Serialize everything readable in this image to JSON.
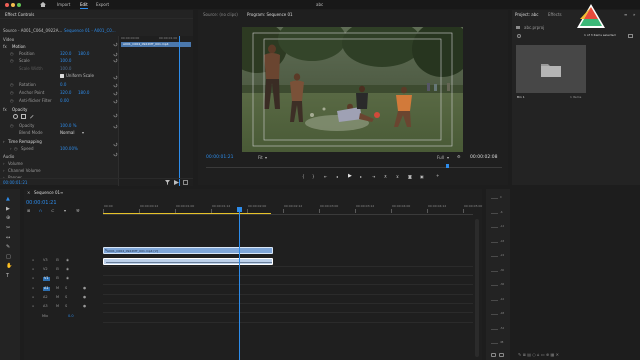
{
  "app": {
    "window_title": "abc",
    "nav": [
      "Import",
      "Edit",
      "Export"
    ],
    "active_nav": 1
  },
  "effect_controls": {
    "tabs": [
      "Effect Controls",
      "Source: (no clips)"
    ],
    "source_line": "Source - A001_C064_0922A...",
    "sequence_line": "Sequence 01 - A001_C0...",
    "mini_timecode": "00:00:00:00",
    "mini_timecode2": "00:00:01:00",
    "clip_label": "A001_C064_0922MT_001.mp4",
    "sections": {
      "video": "Video",
      "motion": "Motion",
      "opacity": "Opacity",
      "time_remapping": "Time Remapping",
      "audio": "Audio"
    },
    "properties": [
      {
        "label": "Position",
        "value": "320.0",
        "value2": "180.0"
      },
      {
        "label": "Scale",
        "value": "100.0",
        "value2": ""
      },
      {
        "label": "Scale Width",
        "value": "100.0",
        "value2": ""
      },
      {
        "label": "Rotation",
        "value": "0.0",
        "value2": ""
      },
      {
        "label": "Anchor Point",
        "value": "320.0",
        "value2": "180.0"
      },
      {
        "label": "Anti-flicker Filter",
        "value": "0.00",
        "value2": ""
      }
    ],
    "uniform_scale": "Uniform Scale",
    "opacity_label": "Opacity",
    "opacity_value": "100.0 %",
    "blend_mode_label": "Blend Mode",
    "blend_mode_value": "Normal",
    "speed_label": "Speed",
    "speed_value": "100.00%",
    "audio_items": [
      "Volume",
      "Channel Volume",
      "Panner"
    ],
    "bottom_timecode": "00:00:01:21"
  },
  "program": {
    "tabs": [
      "Source: (no clips)",
      "Program: Sequence 01"
    ],
    "timecode": "00:00:01:21",
    "fit": "Fit",
    "quality": "Full",
    "duration": "00:00:02:08"
  },
  "project": {
    "tabs": [
      "Project: abc",
      "Effects"
    ],
    "file_name": "abc.prproj",
    "item_count": "1 of 3 items selected",
    "bin_name": "Bin 1",
    "bin_items": "1 Items"
  },
  "timeline": {
    "sequence_name": "Sequence 01",
    "timecode": "00:00:01:21",
    "ruler": [
      "00:00",
      "00:00:00:12",
      "00:00:01:00",
      "00:00:01:12",
      "00:00:02:00",
      "00:00:02:12",
      "00:00:03:00",
      "00:00:03:12",
      "00:00:04:00",
      "00:00:04:12",
      "00:00:05:00"
    ],
    "tracks": [
      "V3",
      "V2",
      "V1",
      "A1",
      "A2",
      "A3",
      "Mix"
    ],
    "mix_value": "0.0",
    "video_clip": "A001_C064_0922MT_001.mp4 [V]",
    "audio_clip": ""
  },
  "colors": {
    "accent": "#2d8ceb",
    "video_clip": "#7fa6d8",
    "audio_clip": "#bcd0ea",
    "panel": "#232323",
    "work_area": "#e6c229"
  },
  "meter_scale": [
    "0",
    "-6",
    "-12",
    "-18",
    "-24",
    "-30",
    "-36",
    "-42",
    "-48",
    "-54",
    "dB"
  ]
}
